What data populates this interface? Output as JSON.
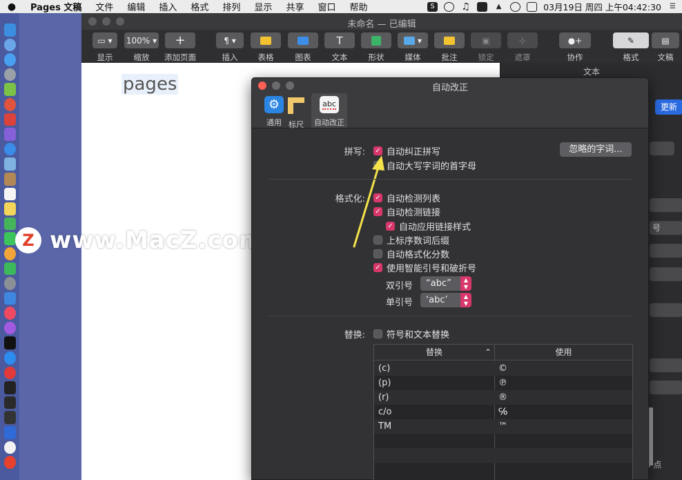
{
  "menubar": {
    "app_name": "Pages 文稿",
    "items": [
      "文件",
      "编辑",
      "插入",
      "格式",
      "排列",
      "显示",
      "共享",
      "窗口",
      "帮助"
    ],
    "clock": "03月19日 周四 上午04:42:30"
  },
  "window": {
    "title": "未命名 — 已编辑"
  },
  "toolbar": {
    "view": "显示",
    "zoom_value": "100%",
    "zoom": "缩放",
    "add_page": "添加页面",
    "insert": "插入",
    "table": "表格",
    "chart": "图表",
    "text": "文本",
    "shape": "形状",
    "media": "媒体",
    "comment": "批注",
    "lock": "锁定",
    "mask": "遮罩",
    "collaborate": "协作",
    "format": "格式",
    "document": "文稿"
  },
  "document": {
    "body_text": "pages"
  },
  "sidebar": {
    "title": "文本",
    "update_button": "更新",
    "fragment_hao": "号",
    "fragment_pt": "6 点"
  },
  "watermark": {
    "logo": "Z",
    "text": "www.MacZ.com"
  },
  "dialog": {
    "title": "自动改正",
    "tabs": [
      {
        "label": "通用",
        "icon": "gear-icon"
      },
      {
        "label": "标尺",
        "icon": "ruler-icon"
      },
      {
        "label": "自动改正",
        "icon": "abc",
        "selected": true
      }
    ],
    "spelling": {
      "label": "拼写:",
      "autocorrect": {
        "label": "自动纠正拼写",
        "checked": true
      },
      "capitalize": {
        "label": "自动大写字词的首字母",
        "checked": false
      },
      "ignored_words_button": "忽略的字词..."
    },
    "formatting": {
      "label": "格式化:",
      "options": [
        {
          "label": "自动检测列表",
          "checked": true
        },
        {
          "label": "自动检测链接",
          "checked": true
        },
        {
          "label": "自动应用链接样式",
          "checked": true
        },
        {
          "label": "上标序数词后缀",
          "checked": false
        },
        {
          "label": "自动格式化分数",
          "checked": false
        },
        {
          "label": "使用智能引号和破折号",
          "checked": true
        }
      ],
      "double_quote_label": "双引号",
      "double_quote_value": "“abc”",
      "single_quote_label": "单引号",
      "single_quote_value": "‘abc’"
    },
    "replacement": {
      "label": "替换:",
      "checkbox_label": "符号和文本替换",
      "checked": false,
      "col_replace": "替换",
      "col_with": "使用",
      "rows": [
        {
          "replace": "(c)",
          "with": "©"
        },
        {
          "replace": "(p)",
          "with": "℗"
        },
        {
          "replace": "(r)",
          "with": "®"
        },
        {
          "replace": "c/o",
          "with": "℅"
        },
        {
          "replace": "TM",
          "with": "™"
        }
      ]
    }
  },
  "colors": {
    "accent": "#d7376a",
    "dialog_bg": "#323234",
    "update_blue": "#2a6ae0"
  }
}
